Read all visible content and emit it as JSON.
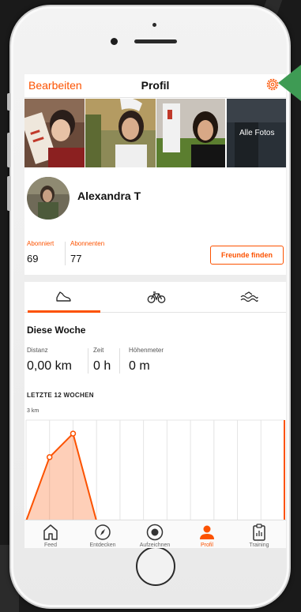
{
  "header": {
    "edit_label": "Bearbeiten",
    "title": "Profil",
    "settings_icon": "gear-icon"
  },
  "photos": {
    "all_photos_label": "Alle Fotos"
  },
  "profile": {
    "name": "Alexandra T"
  },
  "stats": {
    "following_label": "Abonniert",
    "following_value": "69",
    "followers_label": "Abonnenten",
    "followers_value": "77",
    "find_friends_label": "Freunde finden"
  },
  "tabs": [
    {
      "icon": "shoe-icon",
      "active": true
    },
    {
      "icon": "bike-icon",
      "active": false
    },
    {
      "icon": "swim-icon",
      "active": false
    }
  ],
  "week": {
    "title": "Diese Woche",
    "distance_label": "Distanz",
    "distance_value": "0,00 km",
    "time_label": "Zeit",
    "time_value": "0 h",
    "elevation_label": "Höhenmeter",
    "elevation_value": "0 m"
  },
  "chart_data": {
    "type": "area",
    "title": "LETZTE 12 WOCHEN",
    "ylabel": "3 km",
    "x": [
      1,
      2,
      3,
      4,
      5,
      6,
      7,
      8,
      9,
      10,
      11,
      12
    ],
    "values": [
      0,
      1.9,
      2.6,
      0,
      0,
      0,
      0,
      0,
      0,
      0,
      0,
      0
    ],
    "ylim": [
      0,
      3
    ],
    "color": "#fc5200"
  },
  "bottom_nav": [
    {
      "label": "Feed",
      "icon": "home-icon",
      "active": false
    },
    {
      "label": "Entdecken",
      "icon": "compass-icon",
      "active": false
    },
    {
      "label": "Aufzeichnen",
      "icon": "record-icon",
      "active": false
    },
    {
      "label": "Profil",
      "icon": "person-icon",
      "active": true
    },
    {
      "label": "Training",
      "icon": "clipboard-icon",
      "active": false
    }
  ]
}
